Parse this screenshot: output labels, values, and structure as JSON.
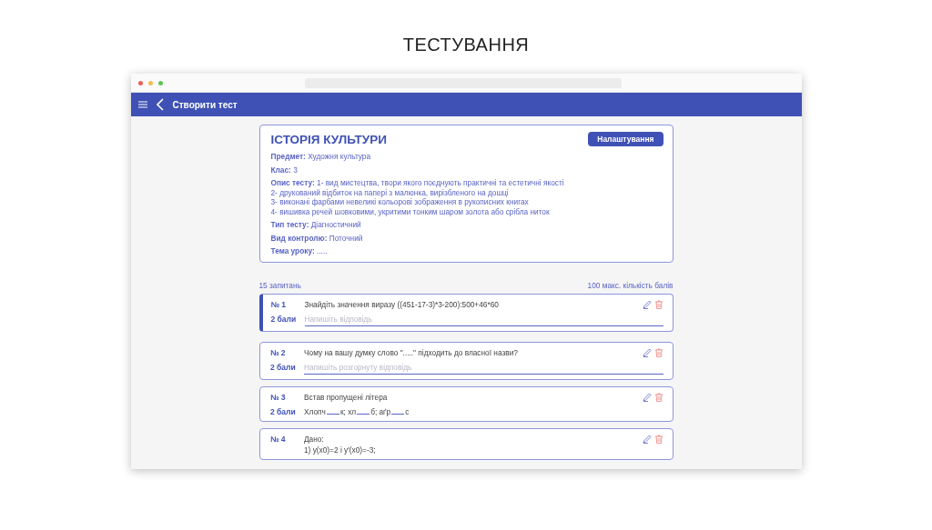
{
  "slide_title": "ТЕСТУВАННЯ",
  "app_bar": {
    "title": "Створити тест"
  },
  "test": {
    "title": "ІСТОРІЯ КУЛЬТУРИ",
    "settings_button": "Налаштування",
    "fields": [
      {
        "label": "Предмет:",
        "value": [
          "Художня культура"
        ]
      },
      {
        "label": "Клас:",
        "value": [
          "3"
        ]
      },
      {
        "label": "Опис тесту:",
        "value": [
          "1- вид мистецтва, твори якого поєднують практичні та естетичні якості",
          "2- друкований відбиток на папері з малюнка, вирізбленого на дошці",
          "3- виконані фарбами невеликі кольорові зображення в рукописних книгах",
          "4- вишивка речей шовковими, укритими тонким шаром золота або срібла ниток"
        ]
      },
      {
        "label": "Тип тесту:",
        "value": [
          "Діагностичний"
        ]
      },
      {
        "label": "Вид контролю:",
        "value": [
          "Поточний"
        ]
      },
      {
        "label": "Тема уроку:",
        "value": [
          "....."
        ]
      }
    ]
  },
  "question_count": "15 запитань",
  "max_score": "100 макс. кількість балів",
  "questions": [
    {
      "number": "№ 1",
      "text": [
        "Знайдіть значення виразу ((451-17-3)*3-200):500+46*60"
      ],
      "points": "2 бали",
      "kind": "input",
      "placeholder": "Напишіть відповідь",
      "selected": true
    },
    {
      "number": "№ 2",
      "text": [
        "Чому на вашу думку слово  \".....\" підходить до власної назви?"
      ],
      "points": "2 бали",
      "kind": "input",
      "placeholder": "Напишіть розгорнуту відповідь",
      "selected": false
    },
    {
      "number": "№ 3",
      "text": [
        "Встав пропущені літера"
      ],
      "points": "2 бали",
      "kind": "blanks",
      "parts": [
        "Хлопч",
        "к; хл",
        "б; аґр",
        "с"
      ],
      "selected": false
    },
    {
      "number": "№ 4",
      "text": [
        "Дано:",
        "1) y(x0)=2 і y'(x0)=-3;"
      ],
      "kind": "plain",
      "selected": false
    }
  ]
}
